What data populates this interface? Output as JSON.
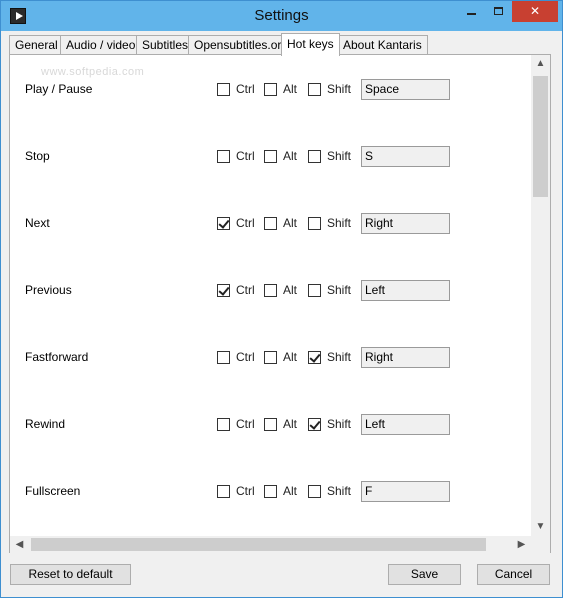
{
  "window": {
    "title": "Settings",
    "close_glyph": "✕",
    "app_icon": "play-icon"
  },
  "tabs": [
    {
      "label": "General",
      "active": false
    },
    {
      "label": "Audio / video",
      "active": false
    },
    {
      "label": "Subtitles",
      "active": false
    },
    {
      "label": "Opensubtitles.org",
      "active": false
    },
    {
      "label": "Hot keys",
      "active": true
    },
    {
      "label": "About Kantaris",
      "active": false
    }
  ],
  "watermark": "www.softpedia.com",
  "modifier_labels": {
    "ctrl": "Ctrl",
    "alt": "Alt",
    "shift": "Shift"
  },
  "hotkeys": [
    {
      "label": "Play / Pause",
      "ctrl": false,
      "alt": false,
      "shift": false,
      "key": "Space"
    },
    {
      "label": "Stop",
      "ctrl": false,
      "alt": false,
      "shift": false,
      "key": "S"
    },
    {
      "label": "Next",
      "ctrl": true,
      "alt": false,
      "shift": false,
      "key": "Right"
    },
    {
      "label": "Previous",
      "ctrl": true,
      "alt": false,
      "shift": false,
      "key": "Left"
    },
    {
      "label": "Fastforward",
      "ctrl": false,
      "alt": false,
      "shift": true,
      "key": "Right"
    },
    {
      "label": "Rewind",
      "ctrl": false,
      "alt": false,
      "shift": true,
      "key": "Left"
    },
    {
      "label": "Fullscreen",
      "ctrl": false,
      "alt": false,
      "shift": false,
      "key": "F"
    }
  ],
  "buttons": {
    "reset": "Reset to default",
    "save": "Save",
    "cancel": "Cancel"
  }
}
